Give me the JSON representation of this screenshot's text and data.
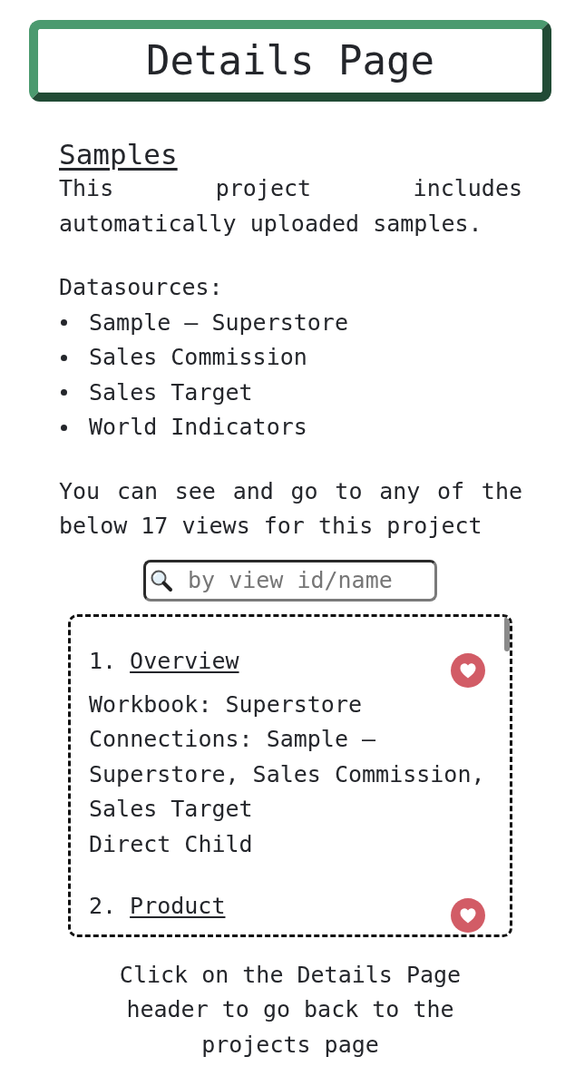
{
  "header": {
    "title": "Details Page"
  },
  "project": {
    "name": "Samples",
    "description": "This project includes automatically uploaded samples.",
    "datasources_label": "Datasources:",
    "datasources": [
      "Sample – Superstore",
      "Sales Commission",
      "Sales Target",
      "World Indicators"
    ],
    "views_note": "You can see and go to any of the below 17 views for this project"
  },
  "search": {
    "placeholder": "by view id/name"
  },
  "views": [
    {
      "number": "1.",
      "name": "Overview",
      "workbook": "Workbook: Superstore",
      "connections": "Connections: Sample – Superstore, Sales Commission, Sales Target",
      "relation": "Direct Child"
    },
    {
      "number": "2.",
      "name": "Product"
    }
  ],
  "footer": {
    "note": "Click on the Details Page header to go back to the projects page"
  }
}
